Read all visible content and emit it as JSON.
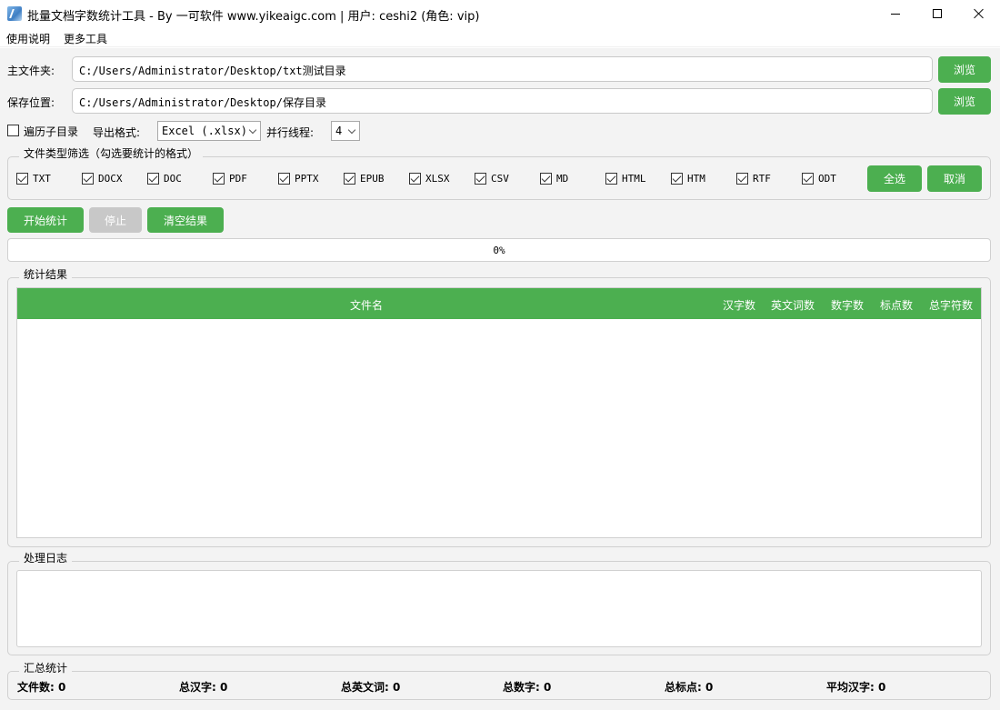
{
  "window": {
    "title": "批量文档字数统计工具 - By 一可软件 www.yikeaigc.com | 用户: ceshi2 (角色: vip)"
  },
  "menu": {
    "help": "使用说明",
    "more_tools": "更多工具"
  },
  "main_folder": {
    "label": "主文件夹:",
    "value": "C:/Users/Administrator/Desktop/txt测试目录",
    "browse": "浏览"
  },
  "save_location": {
    "label": "保存位置:",
    "value": "C:/Users/Administrator/Desktop/保存目录",
    "browse": "浏览"
  },
  "options": {
    "recursive_label": "遍历子目录",
    "recursive_checked": false,
    "export_label": "导出格式:",
    "export_value": "Excel (.xlsx)",
    "threads_label": "并行线程:",
    "threads_value": "4"
  },
  "file_filter": {
    "title": "文件类型筛选（勾选要统计的格式）",
    "types": [
      "TXT",
      "DOCX",
      "DOC",
      "PDF",
      "PPTX",
      "EPUB",
      "XLSX",
      "CSV",
      "MD",
      "HTML",
      "HTM",
      "RTF",
      "ODT"
    ],
    "select_all": "全选",
    "cancel": "取消"
  },
  "actions": {
    "start": "开始统计",
    "stop": "停止",
    "clear": "清空结果"
  },
  "progress": {
    "percent": 0,
    "text": "0%"
  },
  "results": {
    "title": "统计结果",
    "columns": [
      "文件名",
      "汉字数",
      "英文词数",
      "数字数",
      "标点数",
      "总字符数"
    ],
    "rows": []
  },
  "log": {
    "title": "处理日志"
  },
  "summary": {
    "title": "汇总统计",
    "items": [
      {
        "label": "文件数:",
        "value": "0"
      },
      {
        "label": "总汉字:",
        "value": "0"
      },
      {
        "label": "总英文词:",
        "value": "0"
      },
      {
        "label": "总数字:",
        "value": "0"
      },
      {
        "label": "总标点:",
        "value": "0"
      },
      {
        "label": "平均汉字:",
        "value": "0"
      }
    ]
  },
  "colors": {
    "accent": "#4caf50",
    "disabled": "#c8c8c8",
    "background": "#f3f3f3"
  }
}
